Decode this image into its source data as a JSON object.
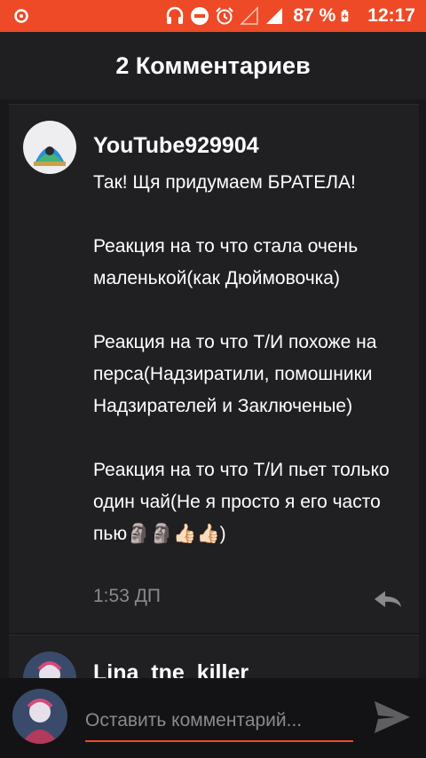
{
  "status_bar": {
    "battery_percent": "87 %",
    "time": "12:17",
    "icons": [
      "notification-icon",
      "headphones-icon",
      "do-not-disturb-icon",
      "alarm-icon",
      "signal-icon",
      "battery-icon"
    ],
    "background_color": "#ee4a27"
  },
  "header": {
    "title": "2 Комментариев"
  },
  "comments": [
    {
      "author": "YouTube929904",
      "text": "Так! Щя придумаем БРАТЕЛА!\n\nРеакция на то что стала очень маленькой(как Дюймовочка)\n\nРеакция на то что Т/И похоже на перса(Надзиратили, помошники Надзирателей и Заключеные)\n\nРеакция на то что Т/И пьет только один чай(Не я просто я его часто пью🗿🗿👍🏻👍🏻)",
      "time": "1:53 ДП"
    },
    {
      "author": "Lina_tne_killer"
    }
  ],
  "composer": {
    "placeholder": "Оставить комментарий..."
  },
  "colors": {
    "accent": "#ee4a27",
    "card": "#202023",
    "background": "#18181a"
  }
}
